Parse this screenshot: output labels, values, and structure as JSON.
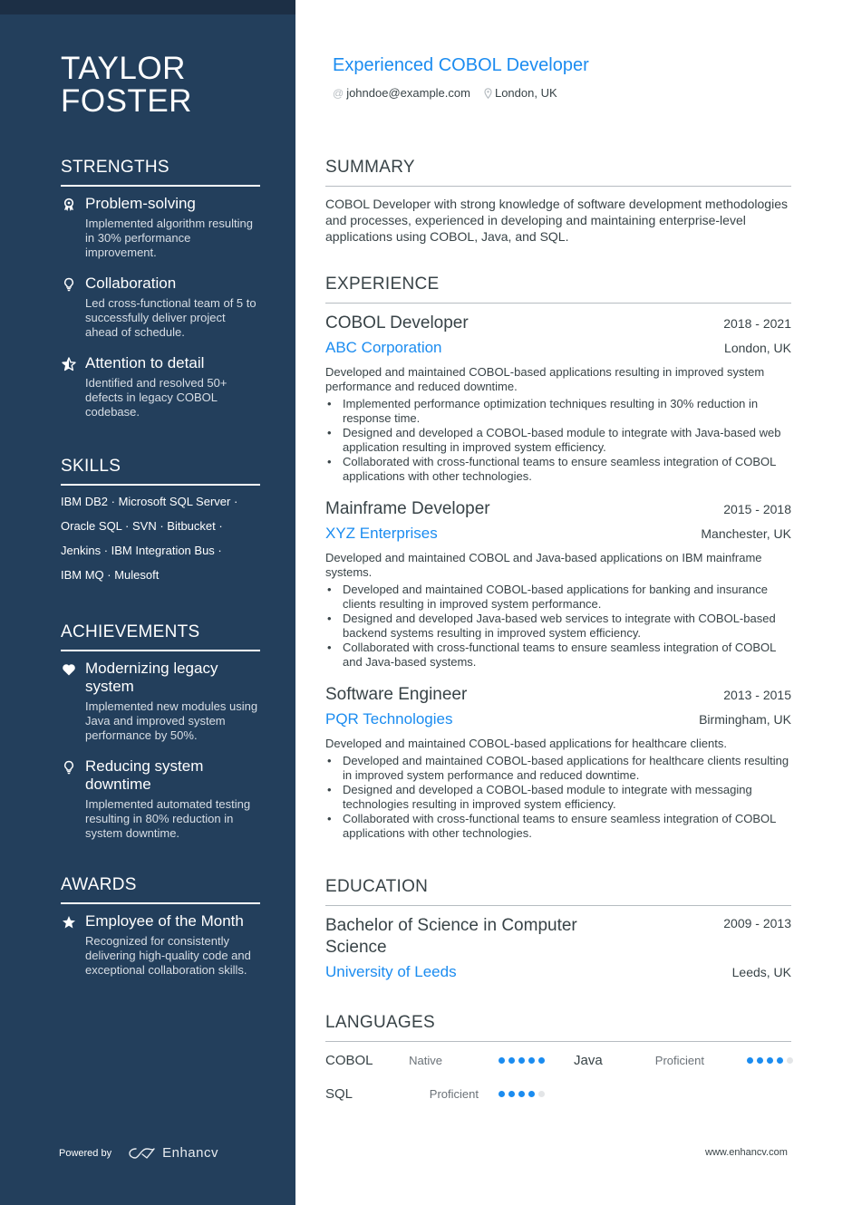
{
  "profile": {
    "name_line1": "TAYLOR",
    "name_line2": "FOSTER",
    "headline": "Experienced COBOL Developer",
    "email": "johndoe@example.com",
    "location": "London, UK"
  },
  "sidebar": {
    "strengths": {
      "title": "STRENGTHS",
      "items": [
        {
          "icon": "award-ribbon-icon",
          "title": "Problem-solving",
          "desc": "Implemented algorithm resulting in 30% performance improvement."
        },
        {
          "icon": "lightbulb-icon",
          "title": "Collaboration",
          "desc": "Led cross-functional team of 5 to successfully deliver project ahead of schedule."
        },
        {
          "icon": "star-half-icon",
          "title": "Attention to detail",
          "desc": "Identified and resolved 50+ defects in legacy COBOL codebase."
        }
      ]
    },
    "skills": {
      "title": "SKILLS",
      "lines": [
        "IBM DB2 · Microsoft SQL Server ·",
        "Oracle SQL · SVN · Bitbucket ·",
        "Jenkins · IBM Integration Bus ·",
        "IBM MQ · Mulesoft"
      ]
    },
    "achievements": {
      "title": "ACHIEVEMENTS",
      "items": [
        {
          "icon": "heart-icon",
          "title": "Modernizing legacy system",
          "desc": "Implemented new modules using Java and improved system performance by 50%."
        },
        {
          "icon": "lightbulb-icon",
          "title": "Reducing system downtime",
          "desc": "Implemented automated testing resulting in 80% reduction in system downtime."
        }
      ]
    },
    "awards": {
      "title": "AWARDS",
      "items": [
        {
          "icon": "star-icon",
          "title": "Employee of the Month",
          "desc": "Recognized for consistently delivering high-quality code and exceptional collaboration skills."
        }
      ]
    },
    "powered_by": "Powered by",
    "brand": "Enhancv"
  },
  "main": {
    "summary": {
      "title": "SUMMARY",
      "text": "COBOL Developer with strong knowledge of software development methodologies and processes, experienced in developing and maintaining enterprise-level applications using COBOL, Java, and SQL."
    },
    "experience": {
      "title": "EXPERIENCE",
      "jobs": [
        {
          "title": "COBOL Developer",
          "dates": "2018 - 2021",
          "company": "ABC Corporation",
          "location": "London, UK",
          "desc": "Developed and maintained COBOL-based applications resulting in improved system performance and reduced downtime.",
          "bullets": [
            "Implemented performance optimization techniques resulting in 30% reduction in response time.",
            "Designed and developed a COBOL-based module to integrate with Java-based web application resulting in improved system efficiency.",
            "Collaborated with cross-functional teams to ensure seamless integration of COBOL applications with other technologies."
          ]
        },
        {
          "title": "Mainframe Developer",
          "dates": "2015 - 2018",
          "company": "XYZ Enterprises",
          "location": "Manchester, UK",
          "desc": "Developed and maintained COBOL and Java-based applications on IBM mainframe systems.",
          "bullets": [
            "Developed and maintained COBOL-based applications for banking and insurance clients resulting in improved system performance.",
            "Designed and developed Java-based web services to integrate with COBOL-based backend systems resulting in improved system efficiency.",
            "Collaborated with cross-functional teams to ensure seamless integration of COBOL and Java-based systems."
          ]
        },
        {
          "title": "Software Engineer",
          "dates": "2013 - 2015",
          "company": "PQR Technologies",
          "location": "Birmingham, UK",
          "desc": "Developed and maintained COBOL-based applications for healthcare clients.",
          "bullets": [
            "Developed and maintained COBOL-based applications for healthcare clients resulting in improved system performance and reduced downtime.",
            "Designed and developed a COBOL-based module to integrate with messaging technologies resulting in improved system efficiency.",
            "Collaborated with cross-functional teams to ensure seamless integration of COBOL applications with other technologies."
          ]
        }
      ]
    },
    "education": {
      "title": "EDUCATION",
      "degree": "Bachelor of Science in Computer Science",
      "dates": "2009 - 2013",
      "school": "University of Leeds",
      "location": "Leeds, UK"
    },
    "languages": {
      "title": "LANGUAGES",
      "items": [
        {
          "name": "COBOL",
          "level": "Native",
          "rating": 5,
          "max": 5
        },
        {
          "name": "Java",
          "level": "Proficient",
          "rating": 4,
          "max": 5
        },
        {
          "name": "SQL",
          "level": "Proficient",
          "rating": 4,
          "max": 5
        }
      ]
    }
  },
  "footer": {
    "url": "www.enhancv.com"
  },
  "colors": {
    "sidebar_bg": "#233f5c",
    "accent": "#1b8cf0",
    "text": "#384347",
    "dot_off": "#e3e5e7"
  }
}
